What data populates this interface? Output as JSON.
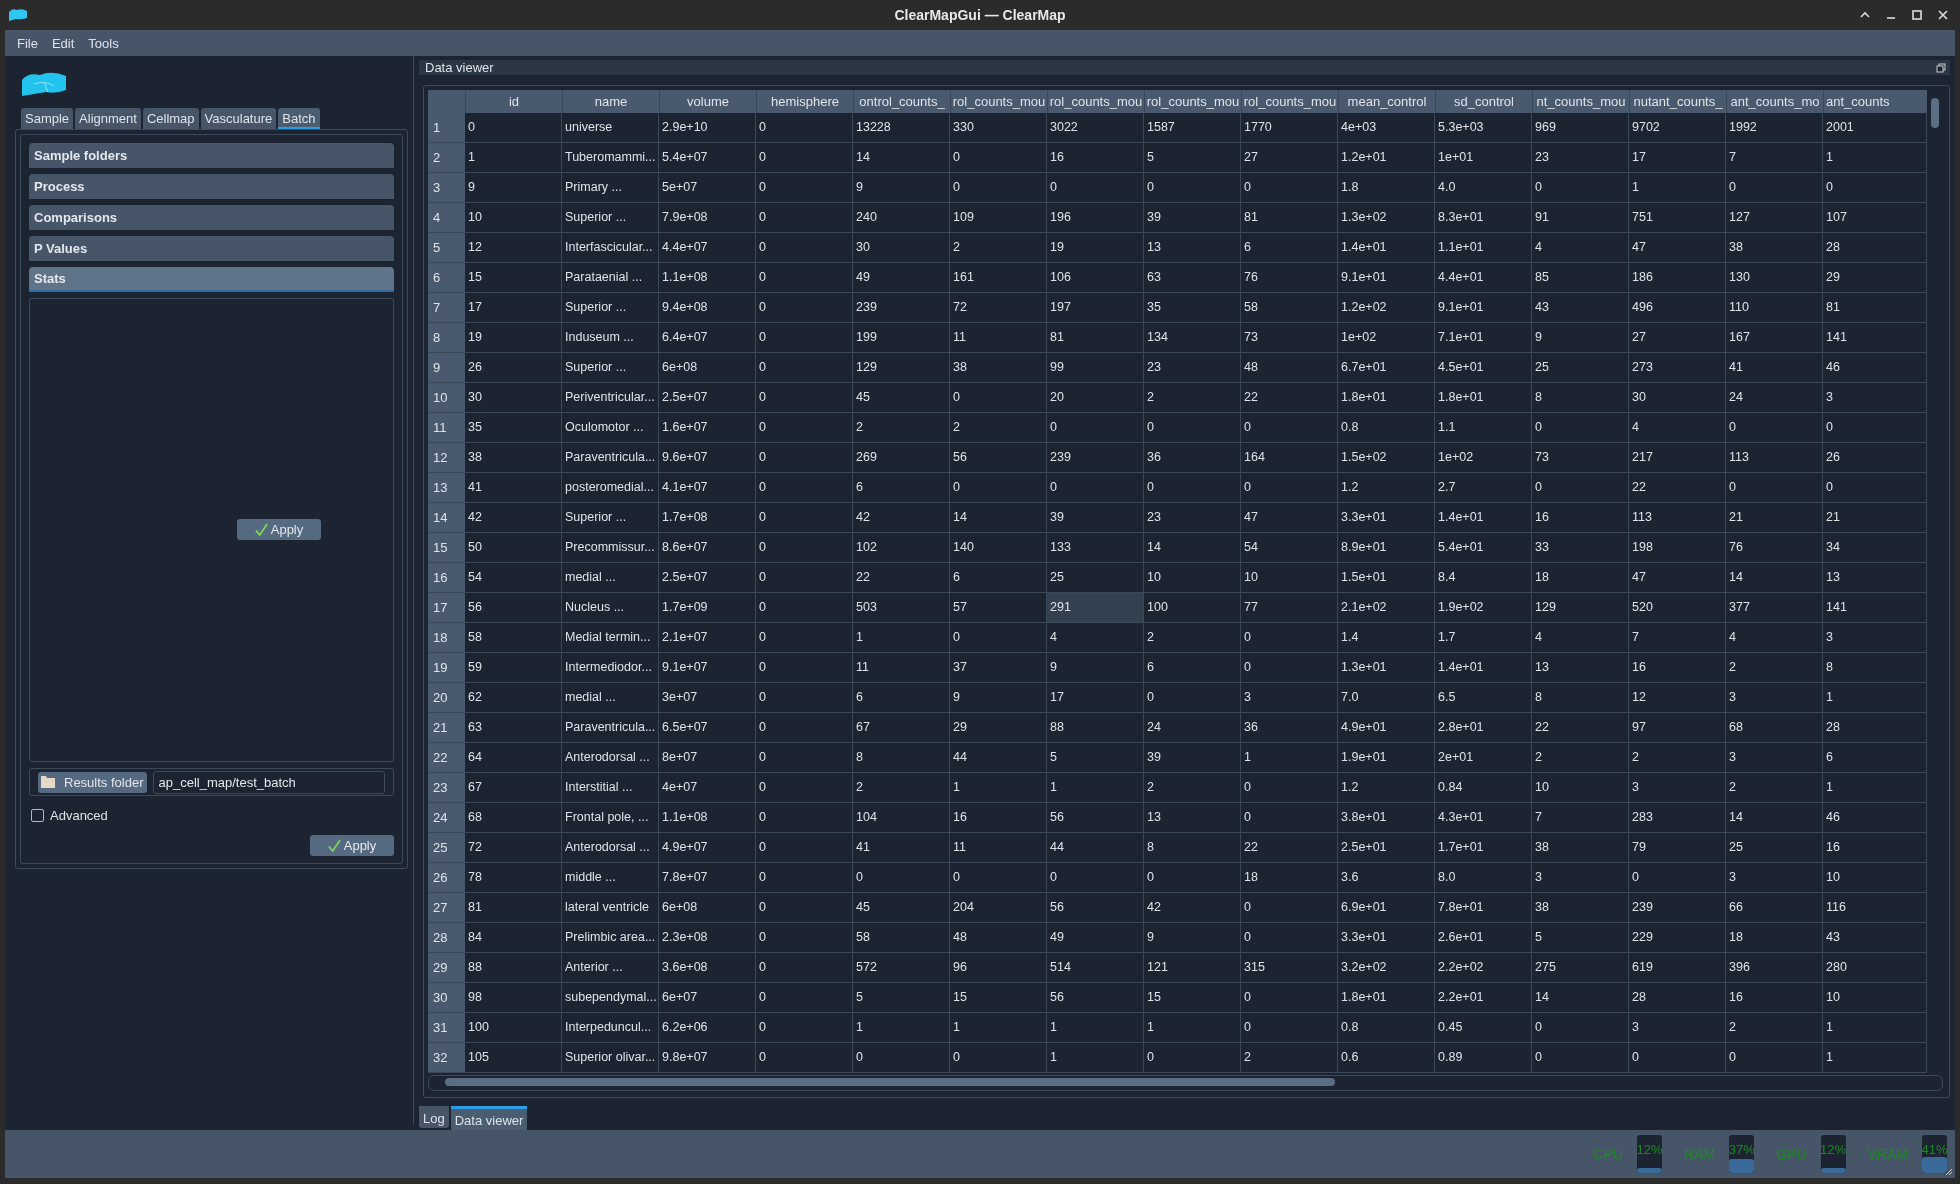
{
  "window": {
    "title": "ClearMapGui — ClearMap"
  },
  "menu": [
    "File",
    "Edit",
    "Tools"
  ],
  "left_panel": {
    "tabs": [
      {
        "label": "Sample",
        "selected": false
      },
      {
        "label": "Alignment",
        "selected": false
      },
      {
        "label": "Cellmap",
        "selected": false
      },
      {
        "label": "Vasculature",
        "selected": false
      },
      {
        "label": "Batch",
        "selected": true
      }
    ],
    "sections": [
      {
        "label": "Sample folders",
        "expanded": false
      },
      {
        "label": "Process",
        "expanded": false
      },
      {
        "label": "Comparisons",
        "expanded": false
      },
      {
        "label": "P Values",
        "expanded": false
      },
      {
        "label": "Stats",
        "expanded": true
      }
    ],
    "stats_apply": "Apply",
    "results_folder": {
      "button": "Results folder",
      "value": "ap_cell_map/test_batch"
    },
    "advanced": {
      "label": "Advanced",
      "checked": false
    },
    "apply": "Apply"
  },
  "dock": {
    "title": "Data viewer"
  },
  "table": {
    "columns": [
      "id",
      "name",
      "volume",
      "hemisphere",
      "ontrol_counts_",
      "rol_counts_mou",
      "rol_counts_mou",
      "rol_counts_mou",
      "rol_counts_mou",
      "mean_control",
      "sd_control",
      "nt_counts_mou",
      "nutant_counts_",
      "ant_counts_mo",
      "ant_counts"
    ],
    "rows": [
      {
        "number": "1",
        "cells": [
          "0",
          "universe",
          "2.9e+10",
          "0",
          "13228",
          "330",
          "3022",
          "1587",
          "1770",
          "4e+03",
          "5.3e+03",
          "969",
          "9702",
          "1992",
          "2001"
        ]
      },
      {
        "number": "2",
        "cells": [
          "1",
          "Tuberomammi...",
          "5.4e+07",
          "0",
          "14",
          "0",
          "16",
          "5",
          "27",
          "1.2e+01",
          "1e+01",
          "23",
          "17",
          "7",
          "1"
        ]
      },
      {
        "number": "3",
        "cells": [
          "9",
          "Primary ...",
          "5e+07",
          "0",
          "9",
          "0",
          "0",
          "0",
          "0",
          "1.8",
          "4.0",
          "0",
          "1",
          "0",
          "0"
        ]
      },
      {
        "number": "4",
        "cells": [
          "10",
          "Superior ...",
          "7.9e+08",
          "0",
          "240",
          "109",
          "196",
          "39",
          "81",
          "1.3e+02",
          "8.3e+01",
          "91",
          "751",
          "127",
          "107"
        ]
      },
      {
        "number": "5",
        "cells": [
          "12",
          "Interfascicular...",
          "4.4e+07",
          "0",
          "30",
          "2",
          "19",
          "13",
          "6",
          "1.4e+01",
          "1.1e+01",
          "4",
          "47",
          "38",
          "28"
        ]
      },
      {
        "number": "6",
        "cells": [
          "15",
          "Parataenial ...",
          "1.1e+08",
          "0",
          "49",
          "161",
          "106",
          "63",
          "76",
          "9.1e+01",
          "4.4e+01",
          "85",
          "186",
          "130",
          "29"
        ]
      },
      {
        "number": "7",
        "cells": [
          "17",
          "Superior ...",
          "9.4e+08",
          "0",
          "239",
          "72",
          "197",
          "35",
          "58",
          "1.2e+02",
          "9.1e+01",
          "43",
          "496",
          "110",
          "81"
        ]
      },
      {
        "number": "8",
        "cells": [
          "19",
          "Induseum ...",
          "6.4e+07",
          "0",
          "199",
          "11",
          "81",
          "134",
          "73",
          "1e+02",
          "7.1e+01",
          "9",
          "27",
          "167",
          "141"
        ]
      },
      {
        "number": "9",
        "cells": [
          "26",
          "Superior ...",
          "6e+08",
          "0",
          "129",
          "38",
          "99",
          "23",
          "48",
          "6.7e+01",
          "4.5e+01",
          "25",
          "273",
          "41",
          "46"
        ]
      },
      {
        "number": "10",
        "cells": [
          "30",
          "Periventricular...",
          "2.5e+07",
          "0",
          "45",
          "0",
          "20",
          "2",
          "22",
          "1.8e+01",
          "1.8e+01",
          "8",
          "30",
          "24",
          "3"
        ]
      },
      {
        "number": "11",
        "cells": [
          "35",
          "Oculomotor ...",
          "1.6e+07",
          "0",
          "2",
          "2",
          "0",
          "0",
          "0",
          "0.8",
          "1.1",
          "0",
          "4",
          "0",
          "0"
        ]
      },
      {
        "number": "12",
        "cells": [
          "38",
          "Paraventricula...",
          "9.6e+07",
          "0",
          "269",
          "56",
          "239",
          "36",
          "164",
          "1.5e+02",
          "1e+02",
          "73",
          "217",
          "113",
          "26"
        ]
      },
      {
        "number": "13",
        "cells": [
          "41",
          "posteromedial...",
          "4.1e+07",
          "0",
          "6",
          "0",
          "0",
          "0",
          "0",
          "1.2",
          "2.7",
          "0",
          "22",
          "0",
          "0"
        ]
      },
      {
        "number": "14",
        "cells": [
          "42",
          "Superior ...",
          "1.7e+08",
          "0",
          "42",
          "14",
          "39",
          "23",
          "47",
          "3.3e+01",
          "1.4e+01",
          "16",
          "113",
          "21",
          "21"
        ]
      },
      {
        "number": "15",
        "cells": [
          "50",
          "Precommissur...",
          "8.6e+07",
          "0",
          "102",
          "140",
          "133",
          "14",
          "54",
          "8.9e+01",
          "5.4e+01",
          "33",
          "198",
          "76",
          "34"
        ]
      },
      {
        "number": "16",
        "cells": [
          "54",
          "medial ...",
          "2.5e+07",
          "0",
          "22",
          "6",
          "25",
          "10",
          "10",
          "1.5e+01",
          "8.4",
          "18",
          "47",
          "14",
          "13"
        ]
      },
      {
        "number": "17",
        "cells": [
          "56",
          "Nucleus ...",
          "1.7e+09",
          "0",
          "503",
          "57",
          {
            "text": "291",
            "selected": true
          },
          "100",
          "77",
          "2.1e+02",
          "1.9e+02",
          "129",
          "520",
          "377",
          "141"
        ]
      },
      {
        "number": "18",
        "cells": [
          "58",
          "Medial termin...",
          "2.1e+07",
          "0",
          "1",
          "0",
          "4",
          "2",
          "0",
          "1.4",
          "1.7",
          "4",
          "7",
          "4",
          "3"
        ]
      },
      {
        "number": "19",
        "cells": [
          "59",
          "Intermediodor...",
          "9.1e+07",
          "0",
          "11",
          "37",
          "9",
          "6",
          "0",
          "1.3e+01",
          "1.4e+01",
          "13",
          "16",
          "2",
          "8"
        ]
      },
      {
        "number": "20",
        "cells": [
          "62",
          "medial ...",
          "3e+07",
          "0",
          "6",
          "9",
          "17",
          "0",
          "3",
          "7.0",
          "6.5",
          "8",
          "12",
          "3",
          "1"
        ]
      },
      {
        "number": "21",
        "cells": [
          "63",
          "Paraventricula...",
          "6.5e+07",
          "0",
          "67",
          "29",
          "88",
          "24",
          "36",
          "4.9e+01",
          "2.8e+01",
          "22",
          "97",
          "68",
          "28"
        ]
      },
      {
        "number": "22",
        "cells": [
          "64",
          "Anterodorsal ...",
          "8e+07",
          "0",
          "8",
          "44",
          "5",
          "39",
          "1",
          "1.9e+01",
          "2e+01",
          "2",
          "2",
          "3",
          "6"
        ]
      },
      {
        "number": "23",
        "cells": [
          "67",
          "Interstitial ...",
          "4e+07",
          "0",
          "2",
          "1",
          "1",
          "2",
          "0",
          "1.2",
          "0.84",
          "10",
          "3",
          "2",
          "1"
        ]
      },
      {
        "number": "24",
        "cells": [
          "68",
          "Frontal pole, ...",
          "1.1e+08",
          "0",
          "104",
          "16",
          "56",
          "13",
          "0",
          "3.8e+01",
          "4.3e+01",
          "7",
          "283",
          "14",
          "46"
        ]
      },
      {
        "number": "25",
        "cells": [
          "72",
          "Anterodorsal ...",
          "4.9e+07",
          "0",
          "41",
          "11",
          "44",
          "8",
          "22",
          "2.5e+01",
          "1.7e+01",
          "38",
          "79",
          "25",
          "16"
        ]
      },
      {
        "number": "26",
        "cells": [
          "78",
          "middle ...",
          "7.8e+07",
          "0",
          "0",
          "0",
          "0",
          "0",
          "18",
          "3.6",
          "8.0",
          "3",
          "0",
          "3",
          "10"
        ]
      },
      {
        "number": "27",
        "cells": [
          "81",
          "lateral ventricle",
          "6e+08",
          "0",
          "45",
          "204",
          "56",
          "42",
          "0",
          "6.9e+01",
          "7.8e+01",
          "38",
          "239",
          "66",
          "116"
        ]
      },
      {
        "number": "28",
        "cells": [
          "84",
          "Prelimbic area...",
          "2.3e+08",
          "0",
          "58",
          "48",
          "49",
          "9",
          "0",
          "3.3e+01",
          "2.6e+01",
          "5",
          "229",
          "18",
          "43"
        ]
      },
      {
        "number": "29",
        "cells": [
          "88",
          "Anterior ...",
          "3.6e+08",
          "0",
          "572",
          "96",
          "514",
          "121",
          "315",
          "3.2e+02",
          "2.2e+02",
          "275",
          "619",
          "396",
          "280"
        ]
      },
      {
        "number": "30",
        "cells": [
          "98",
          "subependymal...",
          "6e+07",
          "0",
          "5",
          "15",
          "56",
          "15",
          "0",
          "1.8e+01",
          "2.2e+01",
          "14",
          "28",
          "16",
          "10"
        ]
      },
      {
        "number": "31",
        "cells": [
          "100",
          "Interpeduncul...",
          "6.2e+06",
          "0",
          "1",
          "1",
          "1",
          "1",
          "0",
          "0.8",
          "0.45",
          "0",
          "3",
          "2",
          "1"
        ]
      },
      {
        "number": "32",
        "cells": [
          "105",
          "Superior olivar...",
          "9.8e+07",
          "0",
          "0",
          "0",
          "1",
          "0",
          "2",
          "0.6",
          "0.89",
          "0",
          "0",
          "0",
          "1"
        ]
      }
    ]
  },
  "bottom_tabs": [
    {
      "label": "Log",
      "selected": false
    },
    {
      "label": "Data viewer",
      "selected": true
    }
  ],
  "status_bar": {
    "meters": [
      {
        "label": "CPU",
        "reading": "12%",
        "level": 0.12
      },
      {
        "label": "RAM",
        "reading": "37%",
        "level": 0.37
      },
      {
        "label": "GPU",
        "reading": "12%",
        "level": 0.12
      },
      {
        "label": "VRAM",
        "reading": "41%",
        "level": 0.41
      }
    ]
  }
}
